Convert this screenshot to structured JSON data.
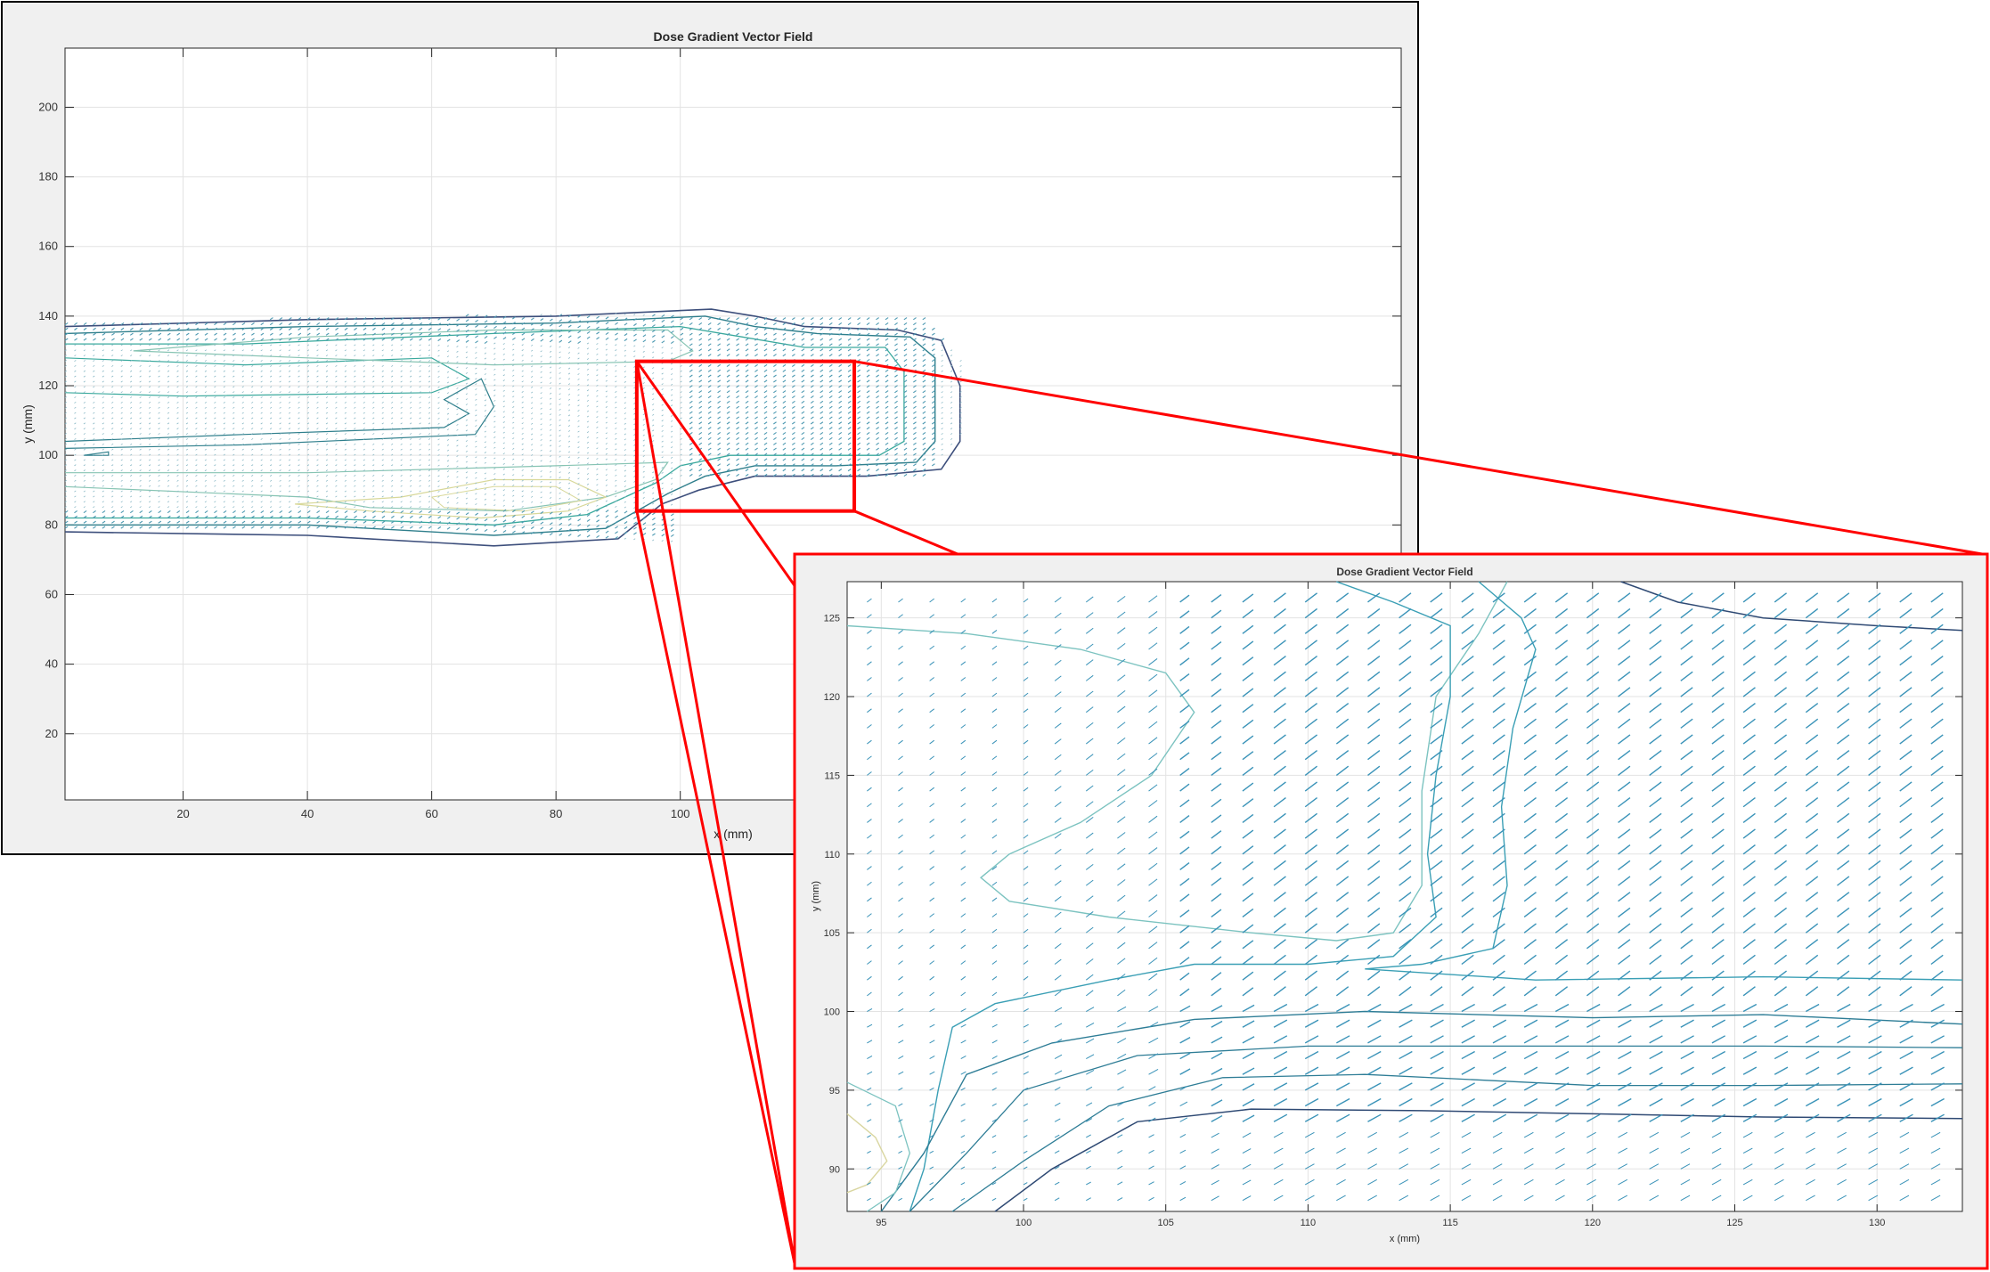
{
  "chart_data": [
    {
      "id": "main",
      "type": "quiver-contour",
      "title": "Dose Gradient Vector Field",
      "xlabel": "x  (mm)",
      "ylabel": "y (mm)",
      "xlim": [
        1,
        216
      ],
      "ylim": [
        1,
        217
      ],
      "xticks": [
        20,
        40,
        60,
        80,
        100
      ],
      "yticks": [
        20,
        40,
        60,
        80,
        100,
        120,
        140,
        160,
        180,
        200
      ],
      "grid": true,
      "zoom_region": {
        "x": [
          93,
          128
        ],
        "y": [
          84,
          127
        ]
      },
      "contour_colors": [
        "#3d4f7c",
        "#2f7f8c",
        "#3aa99d",
        "#87c4b3",
        "#d8d89a"
      ]
    },
    {
      "id": "zoom",
      "type": "quiver-contour",
      "title": "Dose Gradient Vector Field",
      "xlabel": "x (mm)",
      "ylabel": "y (mm)",
      "xlim": [
        93.8,
        133
      ],
      "ylim": [
        87.3,
        127.3
      ],
      "xticks": [
        95,
        100,
        105,
        110,
        115,
        120,
        125,
        130
      ],
      "yticks": [
        90,
        95,
        100,
        105,
        110,
        115,
        120,
        125
      ],
      "grid": true,
      "arrow_color": "#3a93b8",
      "contour_colors": [
        "#2f4a74",
        "#2e7d96",
        "#3a9fb5",
        "#7cc3c0",
        "#d9d6a0"
      ]
    }
  ],
  "annotation": {
    "highlight_color": "#ff0000"
  }
}
